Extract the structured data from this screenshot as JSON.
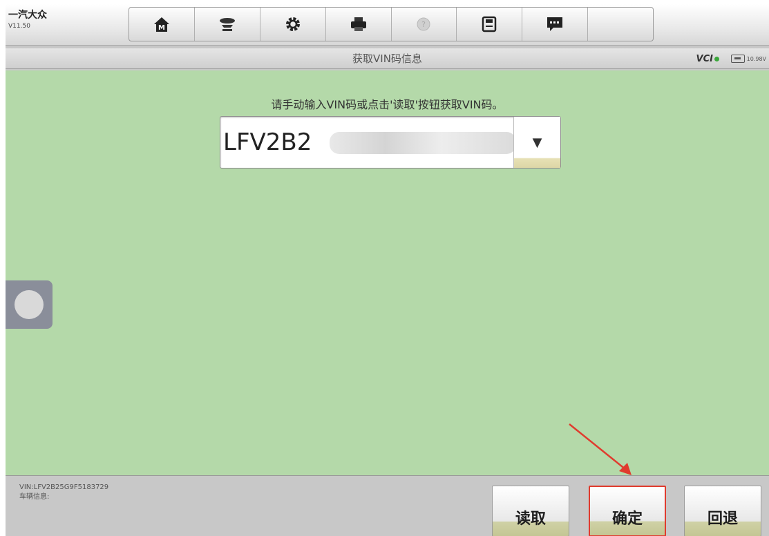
{
  "app": {
    "brand": "一汽大众",
    "version": "V11.50"
  },
  "toolbar": {
    "items": [
      {
        "name": "home",
        "icon": "home-icon"
      },
      {
        "name": "vehicle",
        "icon": "vehicle-lift-icon"
      },
      {
        "name": "settings",
        "icon": "gear-icon"
      },
      {
        "name": "print",
        "icon": "printer-icon"
      },
      {
        "name": "help",
        "icon": "help-icon"
      },
      {
        "name": "save",
        "icon": "save-icon"
      },
      {
        "name": "message",
        "icon": "chat-icon"
      }
    ]
  },
  "titlebar": {
    "title": "获取VIN码信息",
    "vci_label": "VCI",
    "voltage": "10.98V"
  },
  "content": {
    "instruction": "请手动输入VIN码或点击'读取'按钮获取VIN码。",
    "vin_value": "LFV2B2",
    "dropdown_arrow": "▼"
  },
  "bottom": {
    "vin_line": "VIN:LFV2B25G9F5183729",
    "vehicle_info": "车辆信息:",
    "read_label": "读取",
    "ok_label": "确定",
    "back_label": "回退"
  },
  "colors": {
    "content_bg": "#b4d9a9",
    "highlight": "#e03b2e"
  }
}
